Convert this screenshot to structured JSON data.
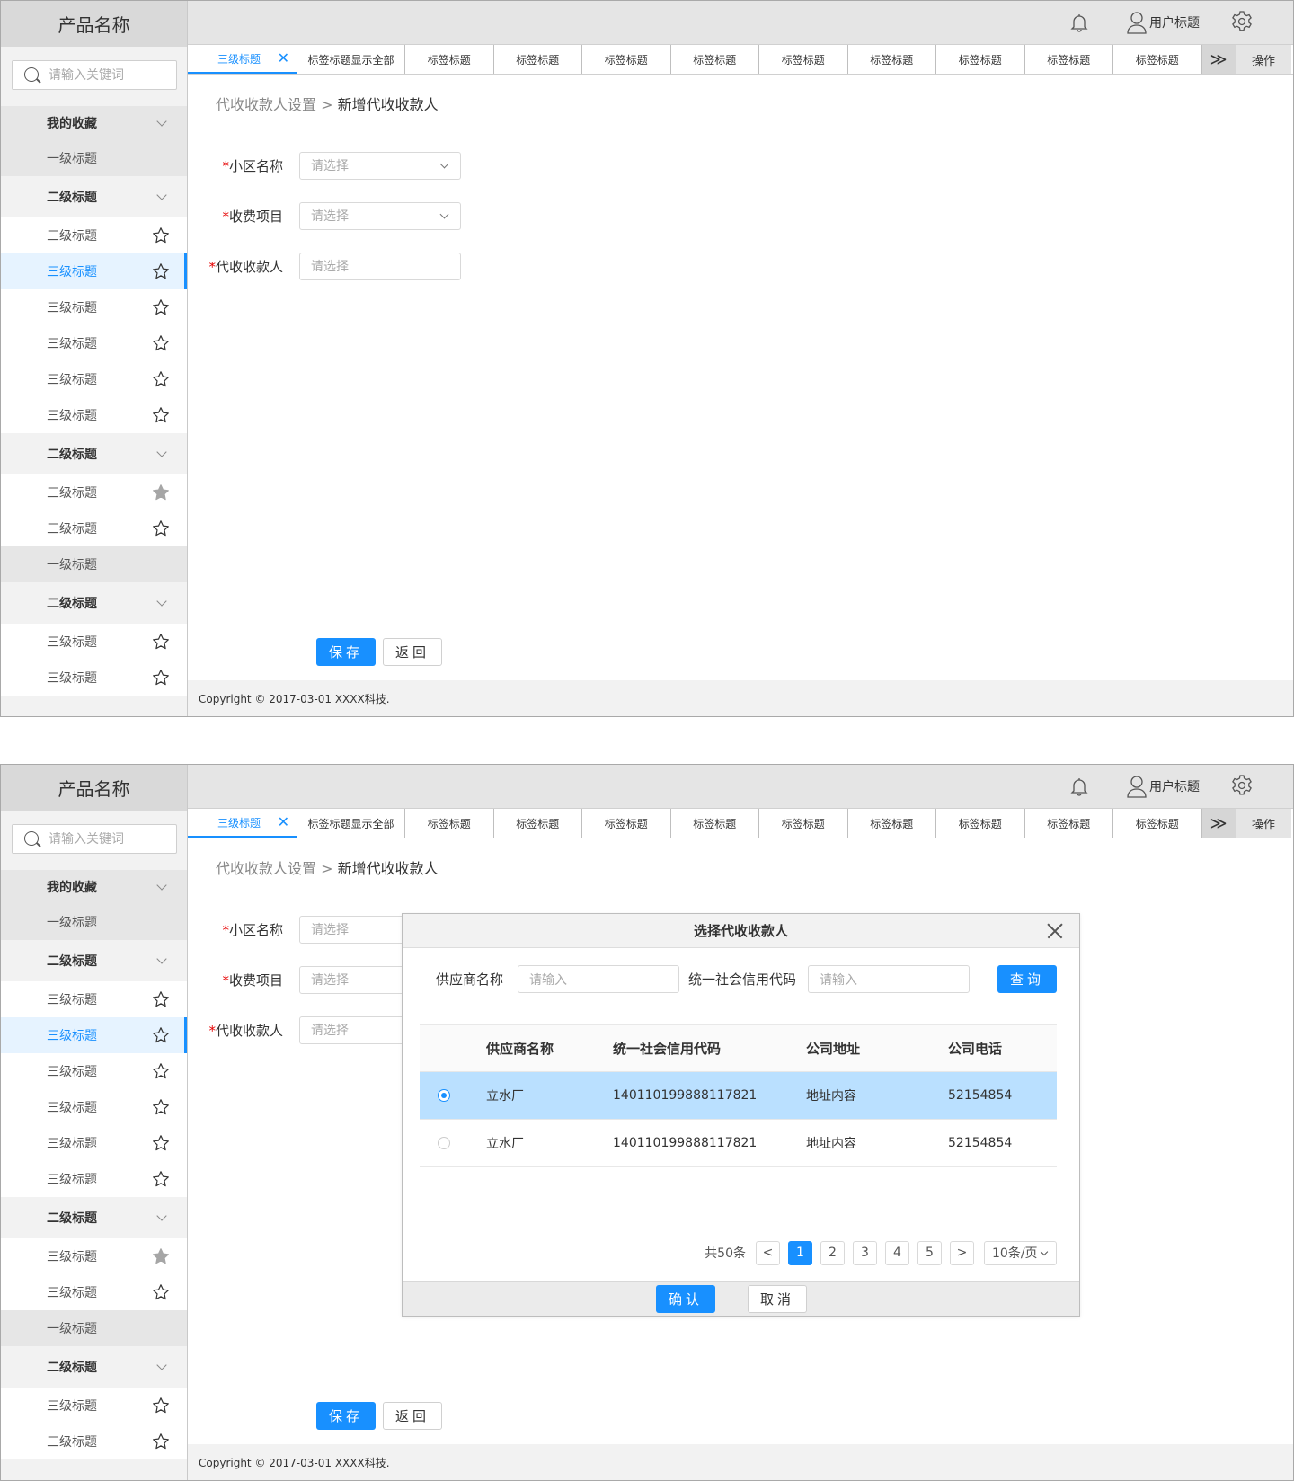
{
  "brand": "产品名称",
  "search_placeholder": "请输入关键词",
  "nav": [
    {
      "label": "我的收藏",
      "kind": "fav-group"
    },
    {
      "label": "一级标题",
      "kind": "l1"
    },
    {
      "label": "二级标题",
      "kind": "l2"
    },
    {
      "label": "三级标题",
      "kind": "l3",
      "star": "outline"
    },
    {
      "label": "三级标题",
      "kind": "l3",
      "star": "outline",
      "active": true
    },
    {
      "label": "三级标题",
      "kind": "l3",
      "star": "outline"
    },
    {
      "label": "三级标题",
      "kind": "l3",
      "star": "outline"
    },
    {
      "label": "三级标题",
      "kind": "l3",
      "star": "outline"
    },
    {
      "label": "三级标题",
      "kind": "l3",
      "star": "outline"
    },
    {
      "label": "二级标题",
      "kind": "l2"
    },
    {
      "label": "三级标题",
      "kind": "l3",
      "star": "filled"
    },
    {
      "label": "三级标题",
      "kind": "l3",
      "star": "outline"
    },
    {
      "label": "一级标题",
      "kind": "l1"
    },
    {
      "label": "二级标题",
      "kind": "l2"
    },
    {
      "label": "三级标题",
      "kind": "l3",
      "star": "outline"
    },
    {
      "label": "三级标题",
      "kind": "l3",
      "star": "outline"
    }
  ],
  "header": {
    "user": "用户标题"
  },
  "tabs": {
    "first": "三级标题",
    "items": [
      "标签标题显示全部",
      "标签标题",
      "标签标题",
      "标签标题",
      "标签标题",
      "标签标题",
      "标签标题",
      "标签标题",
      "标签标题",
      "标签标题"
    ],
    "more": "≫",
    "op": "操作"
  },
  "breadcrumb": {
    "parent": "代收收款人设置",
    "sep": " > ",
    "current": "新增代收收款人"
  },
  "form": {
    "community_label": "小区名称",
    "fee_label": "收费项目",
    "payee_label": "代收收款人",
    "placeholder": "请选择",
    "required_mark": "*"
  },
  "buttons": {
    "save": "保存",
    "back": "返回"
  },
  "footer": "Copyright © 2017-03-01 XXXX科技.",
  "modal": {
    "title": "选择代收收款人",
    "supplier_label": "供应商名称",
    "credit_label": "统一社会信用代码",
    "input_placeholder": "请输入",
    "query": "查询",
    "columns": [
      "供应商名称",
      "统一社会信用代码",
      "公司地址",
      "公司电话"
    ],
    "rows": [
      {
        "name": "立水厂",
        "code": "140110199888117821",
        "address": "地址内容",
        "phone": "52154854",
        "selected": true
      },
      {
        "name": "立水厂",
        "code": "140110199888117821",
        "address": "地址内容",
        "phone": "52154854",
        "selected": false
      }
    ],
    "total": "共50条",
    "prev": "<",
    "next": ">",
    "pages": [
      "1",
      "2",
      "3",
      "4",
      "5"
    ],
    "page_size": "10条/页",
    "confirm": "确认",
    "cancel": "取消"
  },
  "colors": {
    "accent": "#1890ff",
    "selected_row": "#bae0ff",
    "sidebar_bg": "#f2f2f2"
  }
}
